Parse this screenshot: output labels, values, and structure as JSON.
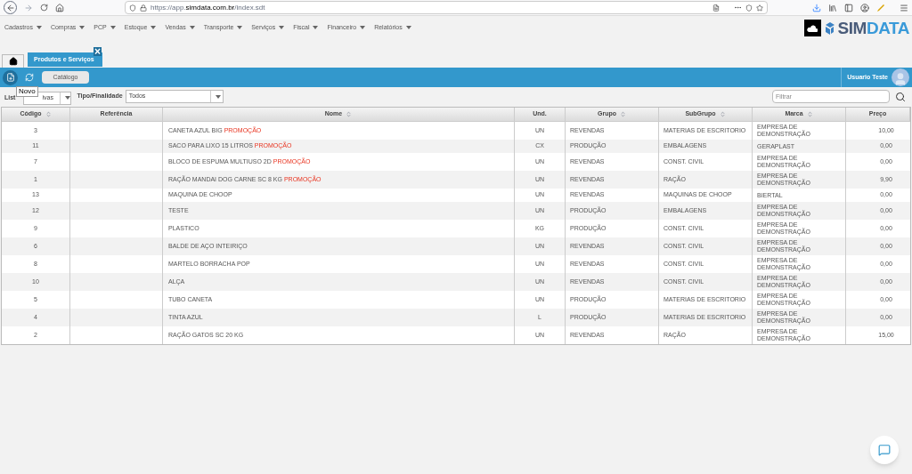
{
  "browser": {
    "url_prefix": "https://app.",
    "url_domain": "simdata.com.br",
    "url_path": "/index.sdt"
  },
  "menu": [
    "Cadastros",
    "Compras",
    "PCP",
    "Estoque",
    "Vendas",
    "Transporte",
    "Serviços",
    "Fiscal",
    "Financeiro",
    "Relatórios"
  ],
  "logo": {
    "part1": "SIM",
    "part2": "DATA"
  },
  "tabs": [
    {
      "kind": "home",
      "selected": false
    },
    {
      "kind": "text",
      "label": "Produtos e Serviços",
      "selected": true,
      "close": "×"
    }
  ],
  "toolbar": {
    "catalog_button": "Catálogo",
    "tooltip": "Novo",
    "user": "Usuario Teste"
  },
  "filters": {
    "lista_label": "List",
    "lista_value": "ivas",
    "tipo_label": "Tipo/Finalidade",
    "tipo_value": "Todos",
    "search_placeholder": "Filtrar"
  },
  "table": {
    "columns": [
      {
        "label": "Código",
        "sortable": true
      },
      {
        "label": "Referência",
        "sortable": false
      },
      {
        "label": "Nome",
        "sortable": true
      },
      {
        "label": "Und.",
        "sortable": false
      },
      {
        "label": "Grupo",
        "sortable": true
      },
      {
        "label": "SubGrupo",
        "sortable": true
      },
      {
        "label": "Marca",
        "sortable": true
      },
      {
        "label": "Preço",
        "sortable": false
      }
    ],
    "rows": [
      {
        "codigo": "3",
        "nome": "CANETA AZUL BIG",
        "tag": "PROMOÇÃO",
        "und": "UN",
        "grupo": "REVENDAS",
        "subgrupo": "MATERIAS DE ESCRITORIO",
        "marca": "EMPRESA DE DEMONSTRAÇÃO",
        "preco": "10,00"
      },
      {
        "codigo": "11",
        "nome": "SACO PARA LIXO 15 LITROS",
        "tag": "PROMOÇÃO",
        "und": "CX",
        "grupo": "PRODUÇÃO",
        "subgrupo": "EMBALAGENS",
        "marca": "GERAPLAST",
        "preco": "0,00"
      },
      {
        "codigo": "7",
        "nome": "BLOCO DE ESPUMA MULTIUSO 2D",
        "tag": "PROMOÇÃO",
        "und": "UN",
        "grupo": "REVENDAS",
        "subgrupo": "CONST. CIVIL",
        "marca": "EMPRESA DE DEMONSTRAÇÃO",
        "preco": "0,00"
      },
      {
        "codigo": "1",
        "nome": "RAÇÃO MANDAI DOG CARNE SC 8 KG",
        "tag": "PROMOÇÃO",
        "und": "UN",
        "grupo": "REVENDAS",
        "subgrupo": "RAÇÃO",
        "marca": "EMPRESA DE DEMONSTRAÇÃO",
        "preco": "9,90"
      },
      {
        "codigo": "13",
        "nome": "MAQUINA DE CHOOP",
        "und": "UN",
        "grupo": "REVENDAS",
        "subgrupo": "MAQUINAS DE CHOOP",
        "marca": "BIERTAL",
        "preco": "0,00"
      },
      {
        "codigo": "12",
        "nome": "TESTE",
        "und": "UN",
        "grupo": "PRODUÇÃO",
        "subgrupo": "EMBALAGENS",
        "marca": "EMPRESA DE DEMONSTRAÇÃO",
        "preco": "0,00"
      },
      {
        "codigo": "9",
        "nome": "PLASTICO",
        "und": "KG",
        "grupo": "PRODUÇÃO",
        "subgrupo": "CONST. CIVIL",
        "marca": "EMPRESA DE DEMONSTRAÇÃO",
        "preco": "0,00"
      },
      {
        "codigo": "6",
        "nome": "BALDE DE AÇO INTEIRIÇO",
        "und": "UN",
        "grupo": "REVENDAS",
        "subgrupo": "CONST. CIVIL",
        "marca": "EMPRESA DE DEMONSTRAÇÃO",
        "preco": "0,00"
      },
      {
        "codigo": "8",
        "nome": "MARTELO BORRACHA POP",
        "und": "UN",
        "grupo": "REVENDAS",
        "subgrupo": "CONST. CIVIL",
        "marca": "EMPRESA DE DEMONSTRAÇÃO",
        "preco": "0,00"
      },
      {
        "codigo": "10",
        "nome": "ALÇA",
        "und": "UN",
        "grupo": "REVENDAS",
        "subgrupo": "CONST. CIVIL",
        "marca": "EMPRESA DE DEMONSTRAÇÃO",
        "preco": "0,00"
      },
      {
        "codigo": "5",
        "nome": "TUBO CANETA",
        "und": "UN",
        "grupo": "PRODUÇÃO",
        "subgrupo": "MATERIAS DE ESCRITORIO",
        "marca": "EMPRESA DE DEMONSTRAÇÃO",
        "preco": "0,00"
      },
      {
        "codigo": "4",
        "nome": "TINTA AZUL",
        "und": "L",
        "grupo": "PRODUÇÃO",
        "subgrupo": "MATERIAS DE ESCRITORIO",
        "marca": "EMPRESA DE DEMONSTRAÇÃO",
        "preco": "0,00"
      },
      {
        "codigo": "2",
        "nome": "RAÇÃO GATOS SC 20 KG",
        "und": "UN",
        "grupo": "REVENDAS",
        "subgrupo": "RAÇÃO",
        "marca": "EMPRESA DE DEMONSTRAÇÃO",
        "preco": "15,00"
      }
    ]
  }
}
